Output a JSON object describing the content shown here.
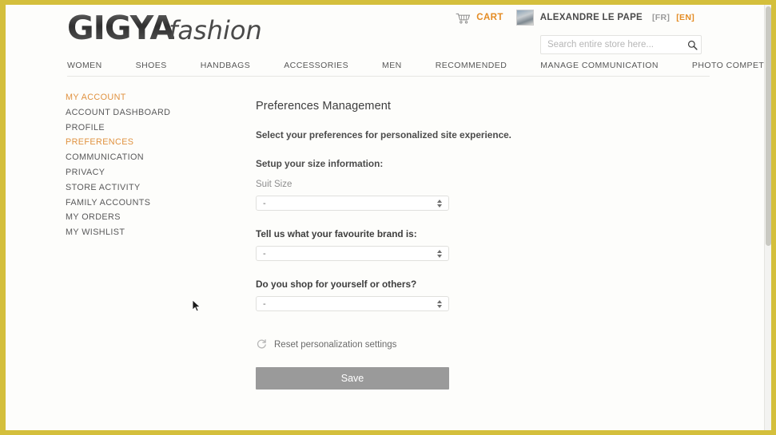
{
  "brand": {
    "logo_main": "GIGYA",
    "logo_sub": "fashion",
    "accent_color": "#e48c24",
    "frame_color": "#d4bf3c"
  },
  "header": {
    "cart_icon": "cart-icon",
    "cart_label": "CART",
    "avatar": "user-avatar",
    "user_name": "ALEXANDRE LE PAPE",
    "lang_fr": "[FR]",
    "lang_en": "[EN]"
  },
  "search": {
    "placeholder": "Search entire store here...",
    "value": "",
    "icon": "search-icon"
  },
  "nav": {
    "items": [
      {
        "label": "WOMEN"
      },
      {
        "label": "SHOES"
      },
      {
        "label": "HANDBAGS"
      },
      {
        "label": "ACCESSORIES"
      },
      {
        "label": "MEN"
      },
      {
        "label": "RECOMMENDED"
      },
      {
        "label": "MANAGE COMMUNICATION"
      },
      {
        "label": "PHOTO COMPETITION"
      }
    ]
  },
  "sidebar": {
    "items": [
      {
        "label": "MY ACCOUNT",
        "active": true
      },
      {
        "label": "ACCOUNT DASHBOARD",
        "active": false
      },
      {
        "label": "PROFILE",
        "active": false
      },
      {
        "label": "PREFERENCES",
        "active": true
      },
      {
        "label": "COMMUNICATION",
        "active": false
      },
      {
        "label": "PRIVACY",
        "active": false
      },
      {
        "label": "STORE ACTIVITY",
        "active": false
      },
      {
        "label": "FAMILY ACCOUNTS",
        "active": false
      },
      {
        "label": "MY ORDERS",
        "active": false
      },
      {
        "label": "MY WISHLIST",
        "active": false
      }
    ]
  },
  "main": {
    "title": "Preferences Management",
    "lead": "Select your preferences for personalized site experience.",
    "size_section_label": "Setup your size information:",
    "suit_size_label": "Suit Size",
    "suit_size_value": "-",
    "brand_question": "Tell us what your favourite brand is:",
    "brand_value": "-",
    "shop_question": "Do you shop for yourself or others?",
    "shop_value": "-",
    "reset_icon": "reset-icon",
    "reset_label": "Reset personalization settings",
    "save_label": "Save"
  },
  "footnote": {
    "text": ""
  }
}
